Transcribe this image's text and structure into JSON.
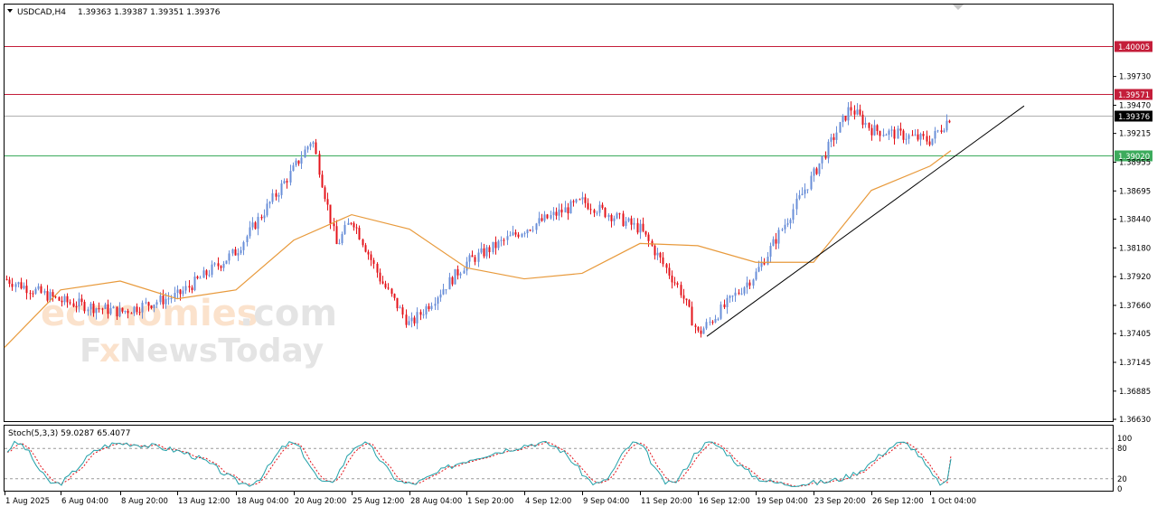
{
  "header": {
    "symbol_label": "USDCAD,H4",
    "ohlc_text": "1.39363 1.39387 1.39351 1.39376"
  },
  "indicator": {
    "label": "Stoch(5,3,3) 59.0287 65.4077",
    "levels": [
      20,
      80
    ],
    "scale_ticks": [
      "100",
      "80",
      "20",
      "0"
    ]
  },
  "watermark": {
    "line1_a": "economies",
    "line1_b": ".com",
    "line2_a": "F",
    "line2_b": "x",
    "line2_c": "NewsToday"
  },
  "colors": {
    "bull": "#6a8fd8",
    "bear": "#e4141b",
    "ma": "#e89a3c",
    "resistance": "#c41e3a",
    "support": "#3cab5c",
    "price_line": "#b0b0b0",
    "trendline": "#000000",
    "stoch_main": "#20a0a8",
    "stoch_signal": "#e4141b"
  },
  "chart_data": {
    "type": "candlestick",
    "symbol": "USDCAD",
    "timeframe": "H4",
    "last_ohlc": {
      "open": 1.39363,
      "high": 1.39387,
      "low": 1.39351,
      "close": 1.39376
    },
    "y_ticks": [
      "1.39730",
      "1.39470",
      "1.39215",
      "1.38955",
      "1.38695",
      "1.38440",
      "1.38180",
      "1.37920",
      "1.37660",
      "1.37405",
      "1.37145",
      "1.36885",
      "1.36630"
    ],
    "ylim": [
      1.3663,
      1.4016
    ],
    "x_ticks": [
      "1 Aug 2025",
      "6 Aug 04:00",
      "8 Aug 20:00",
      "13 Aug 12:00",
      "18 Aug 04:00",
      "20 Aug 20:00",
      "25 Aug 12:00",
      "28 Aug 04:00",
      "1 Sep 20:00",
      "4 Sep 12:00",
      "9 Sep 04:00",
      "11 Sep 20:00",
      "16 Sep 12:00",
      "19 Sep 04:00",
      "23 Sep 20:00",
      "26 Sep 12:00",
      "1 Oct 04:00"
    ],
    "horizontal_levels": [
      {
        "price": 1.40005,
        "label": "1.40005",
        "role": "resistance"
      },
      {
        "price": 1.39571,
        "label": "1.39571",
        "role": "resistance"
      },
      {
        "price": 1.39376,
        "label": "1.39376",
        "role": "current"
      },
      {
        "price": 1.3902,
        "label": "1.39020",
        "role": "support"
      }
    ],
    "trendline": {
      "from": {
        "label": "16 Sep 12:00",
        "price": 1.3738
      },
      "to": {
        "label": "1 Oct 04:00",
        "price": 1.3909
      }
    },
    "key_points": [
      {
        "x": "1 Aug 2025",
        "close": 1.379
      },
      {
        "x": "6 Aug 04:00",
        "close": 1.377
      },
      {
        "x": "8 Aug 20:00",
        "close": 1.376
      },
      {
        "x": "13 Aug 12:00",
        "close": 1.3775
      },
      {
        "x": "18 Aug 04:00",
        "close": 1.3815
      },
      {
        "x": "20 Aug 20:00",
        "close": 1.389
      },
      {
        "x": "21 Aug 08:00",
        "close": 1.3917
      },
      {
        "x": "22 Aug 12:00",
        "close": 1.382
      },
      {
        "x": "25 Aug 12:00",
        "close": 1.3845
      },
      {
        "x": "27 Aug 04:00",
        "close": 1.379
      },
      {
        "x": "28 Aug 04:00",
        "close": 1.3748
      },
      {
        "x": "1 Sep 20:00",
        "close": 1.3805
      },
      {
        "x": "4 Sep 12:00",
        "close": 1.3835
      },
      {
        "x": "9 Sep 04:00",
        "close": 1.386
      },
      {
        "x": "11 Sep 20:00",
        "close": 1.3835
      },
      {
        "x": "12 Sep 12:00",
        "close": 1.378
      },
      {
        "x": "16 Sep 12:00",
        "close": 1.374
      },
      {
        "x": "19 Sep 04:00",
        "close": 1.3795
      },
      {
        "x": "23 Sep 20:00",
        "close": 1.3885
      },
      {
        "x": "24 Sep 20:00",
        "close": 1.3945
      },
      {
        "x": "26 Sep 12:00",
        "close": 1.3925
      },
      {
        "x": "1 Oct 04:00",
        "close": 1.3915
      },
      {
        "x": "last",
        "close": 1.39376
      }
    ],
    "moving_average": [
      {
        "x": "1 Aug 2025",
        "value": 1.3728
      },
      {
        "x": "6 Aug 04:00",
        "value": 1.378
      },
      {
        "x": "8 Aug 20:00",
        "value": 1.3788
      },
      {
        "x": "13 Aug 12:00",
        "value": 1.3772
      },
      {
        "x": "18 Aug 04:00",
        "value": 1.378
      },
      {
        "x": "20 Aug 20:00",
        "value": 1.3825
      },
      {
        "x": "25 Aug 12:00",
        "value": 1.3848
      },
      {
        "x": "28 Aug 04:00",
        "value": 1.3835
      },
      {
        "x": "1 Sep 20:00",
        "value": 1.38
      },
      {
        "x": "4 Sep 12:00",
        "value": 1.379
      },
      {
        "x": "9 Sep 04:00",
        "value": 1.3795
      },
      {
        "x": "11 Sep 20:00",
        "value": 1.3822
      },
      {
        "x": "16 Sep 12:00",
        "value": 1.382
      },
      {
        "x": "19 Sep 04:00",
        "value": 1.3805
      },
      {
        "x": "23 Sep 20:00",
        "value": 1.3805
      },
      {
        "x": "26 Sep 12:00",
        "value": 1.387
      },
      {
        "x": "1 Oct 04:00",
        "value": 1.3892
      }
    ],
    "stochastic": {
      "period": "5,3,3",
      "main": 59.0287,
      "signal": 65.4077,
      "levels": [
        20,
        80
      ]
    }
  }
}
